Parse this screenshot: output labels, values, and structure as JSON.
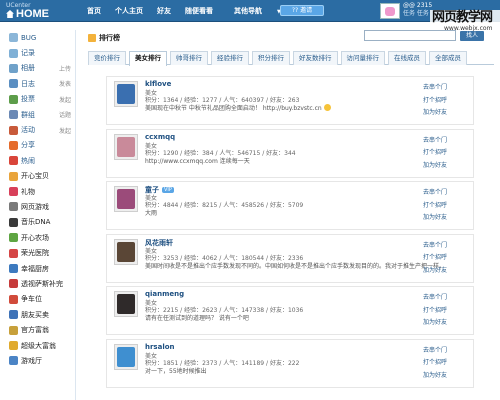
{
  "header": {
    "brand_top": "UCenter",
    "brand_main": "HOME",
    "nav": [
      {
        "label": "首页"
      },
      {
        "label": "个人主页"
      },
      {
        "label": "好友"
      },
      {
        "label": "随便看看"
      },
      {
        "label": "其他导航"
      },
      {
        "label": "搜索"
      }
    ],
    "nav_dropdown_arrow": "▼",
    "invite_button": "?? 邀请",
    "user": {
      "score": "@@ 2315",
      "sub": "任务 任务"
    },
    "watermark_big": "网页教学网",
    "watermark_small": "www.webjx.com"
  },
  "sidebar": {
    "items": [
      {
        "label": "BUG",
        "icon": "bug-icon",
        "color": "#8bb6d8"
      },
      {
        "label": "记录",
        "icon": "record-icon",
        "color": "#7fb0d6"
      },
      {
        "label": "相册",
        "icon": "album-icon",
        "color": "#6fa1c9",
        "extra": "上传"
      },
      {
        "label": "日志",
        "icon": "blog-icon",
        "color": "#5b8fc2",
        "extra": "发表"
      },
      {
        "label": "投票",
        "icon": "poll-icon",
        "color": "#5d9d4a",
        "extra": "发起"
      },
      {
        "label": "群组",
        "icon": "group-icon",
        "color": "#6b89b5",
        "extra": "话题"
      },
      {
        "label": "活动",
        "icon": "event-icon",
        "color": "#c85a3a",
        "extra": "发起"
      },
      {
        "label": "分享",
        "icon": "share-icon",
        "color": "#e56b2b"
      },
      {
        "label": "热闹",
        "icon": "hot-icon",
        "color": "#d9453a"
      },
      {
        "label": "开心宝贝",
        "icon": "baby-icon",
        "color": "#e9a43b",
        "dark": true
      },
      {
        "label": "礼物",
        "icon": "gift-icon",
        "color": "#d8405a",
        "dark": true
      },
      {
        "label": "网页游戏",
        "icon": "game-icon",
        "color": "#7a7a7a",
        "dark": true
      },
      {
        "label": "音乐DNA",
        "icon": "music-icon",
        "color": "#3a3a3a",
        "dark": true
      },
      {
        "label": "开心农场",
        "icon": "farm-icon",
        "color": "#5ea542",
        "dark": true
      },
      {
        "label": "荣光医院",
        "icon": "hospital-icon",
        "color": "#d54545",
        "dark": true
      },
      {
        "label": "幸福厨房",
        "icon": "kitchen-icon",
        "color": "#3d7abf",
        "dark": true
      },
      {
        "label": "透视萨斯补完",
        "icon": "app-icon",
        "color": "#c63b3b",
        "dark": true
      },
      {
        "label": "争车位",
        "icon": "parking-icon",
        "color": "#d14b3b",
        "dark": true
      },
      {
        "label": "朋友买卖",
        "icon": "friends-trade-icon",
        "color": "#3f73b8",
        "dark": true
      },
      {
        "label": "官方富翁",
        "icon": "rich-icon",
        "color": "#c7a03b",
        "dark": true
      },
      {
        "label": "超级大富翁",
        "icon": "monopoly-icon",
        "color": "#e0aa2e",
        "dark": true
      },
      {
        "label": "游戏厅",
        "icon": "arcade-icon",
        "color": "#4b84c5",
        "dark": true
      }
    ]
  },
  "main": {
    "title": "排行榜",
    "search": {
      "placeholder": "",
      "button": "找人"
    },
    "tabs": [
      {
        "label": "竞价排行",
        "active": false
      },
      {
        "label": "美女排行",
        "active": true
      },
      {
        "label": "帅哥排行",
        "active": false
      },
      {
        "label": "经验排行",
        "active": false
      },
      {
        "label": "积分排行",
        "active": false
      },
      {
        "label": "好友数排行",
        "active": false
      },
      {
        "label": "访问量排行",
        "active": false
      },
      {
        "label": "在线成员",
        "active": false
      },
      {
        "label": "全部成员",
        "active": false
      }
    ],
    "actions": {
      "visit": "去串个门",
      "greet": "打个招呼",
      "add": "加为好友"
    },
    "members": [
      {
        "name": "klflove",
        "gender": "美女",
        "stats": "积分：1364 / 经验：1277 / 人气：640397 / 好友：263",
        "note": "美国现在中秋节 中秋节礼品团购全面启动！ http://buy.bzvstc.cn",
        "avatar_color": "#3a6fb0",
        "badge": "",
        "smiley": true
      },
      {
        "name": "ccxmqq",
        "gender": "美女",
        "stats": "积分：1290 / 经验：384 / 人气：546715 / 好友：344",
        "note": "http://www.ccxmqq.com 连续每一天",
        "avatar_color": "#c98a9a",
        "badge": "",
        "smiley": false
      },
      {
        "name": "童子",
        "gender": "美女",
        "stats": "积分：4844 / 经验：8215 / 人气：458526 / 好友：5709",
        "note": "大雨",
        "avatar_color": "#9b4b7a",
        "badge": "VIP",
        "smiley": false
      },
      {
        "name": "风花雨轩",
        "gender": "美女",
        "stats": "积分：3253 / 经验：4062 / 人气：180544 / 好友：2336",
        "note": "美国时间收是不是推出个应手数发现不同的。中国如何收是不是推出个应手数发现目的的。我对于推生产把一样。",
        "avatar_color": "#5a4636",
        "badge": "",
        "smiley": false
      },
      {
        "name": "qianmeng",
        "gender": "美女",
        "stats": "积分：2215 / 经验：2623 / 人气：147338 / 好友：1036",
        "note": "请有在任测试到的道理吗？ 说有一个吧",
        "avatar_color": "#2f2a2a",
        "badge": "",
        "smiley": false
      },
      {
        "name": "hrsalon",
        "gender": "美女",
        "stats": "积分：1851 / 经验：2373 / 人气：141189 / 好友：222",
        "note": "对一下，55地时候推出",
        "avatar_color": "#3f8fd0",
        "badge": "",
        "smiley": false
      }
    ]
  }
}
